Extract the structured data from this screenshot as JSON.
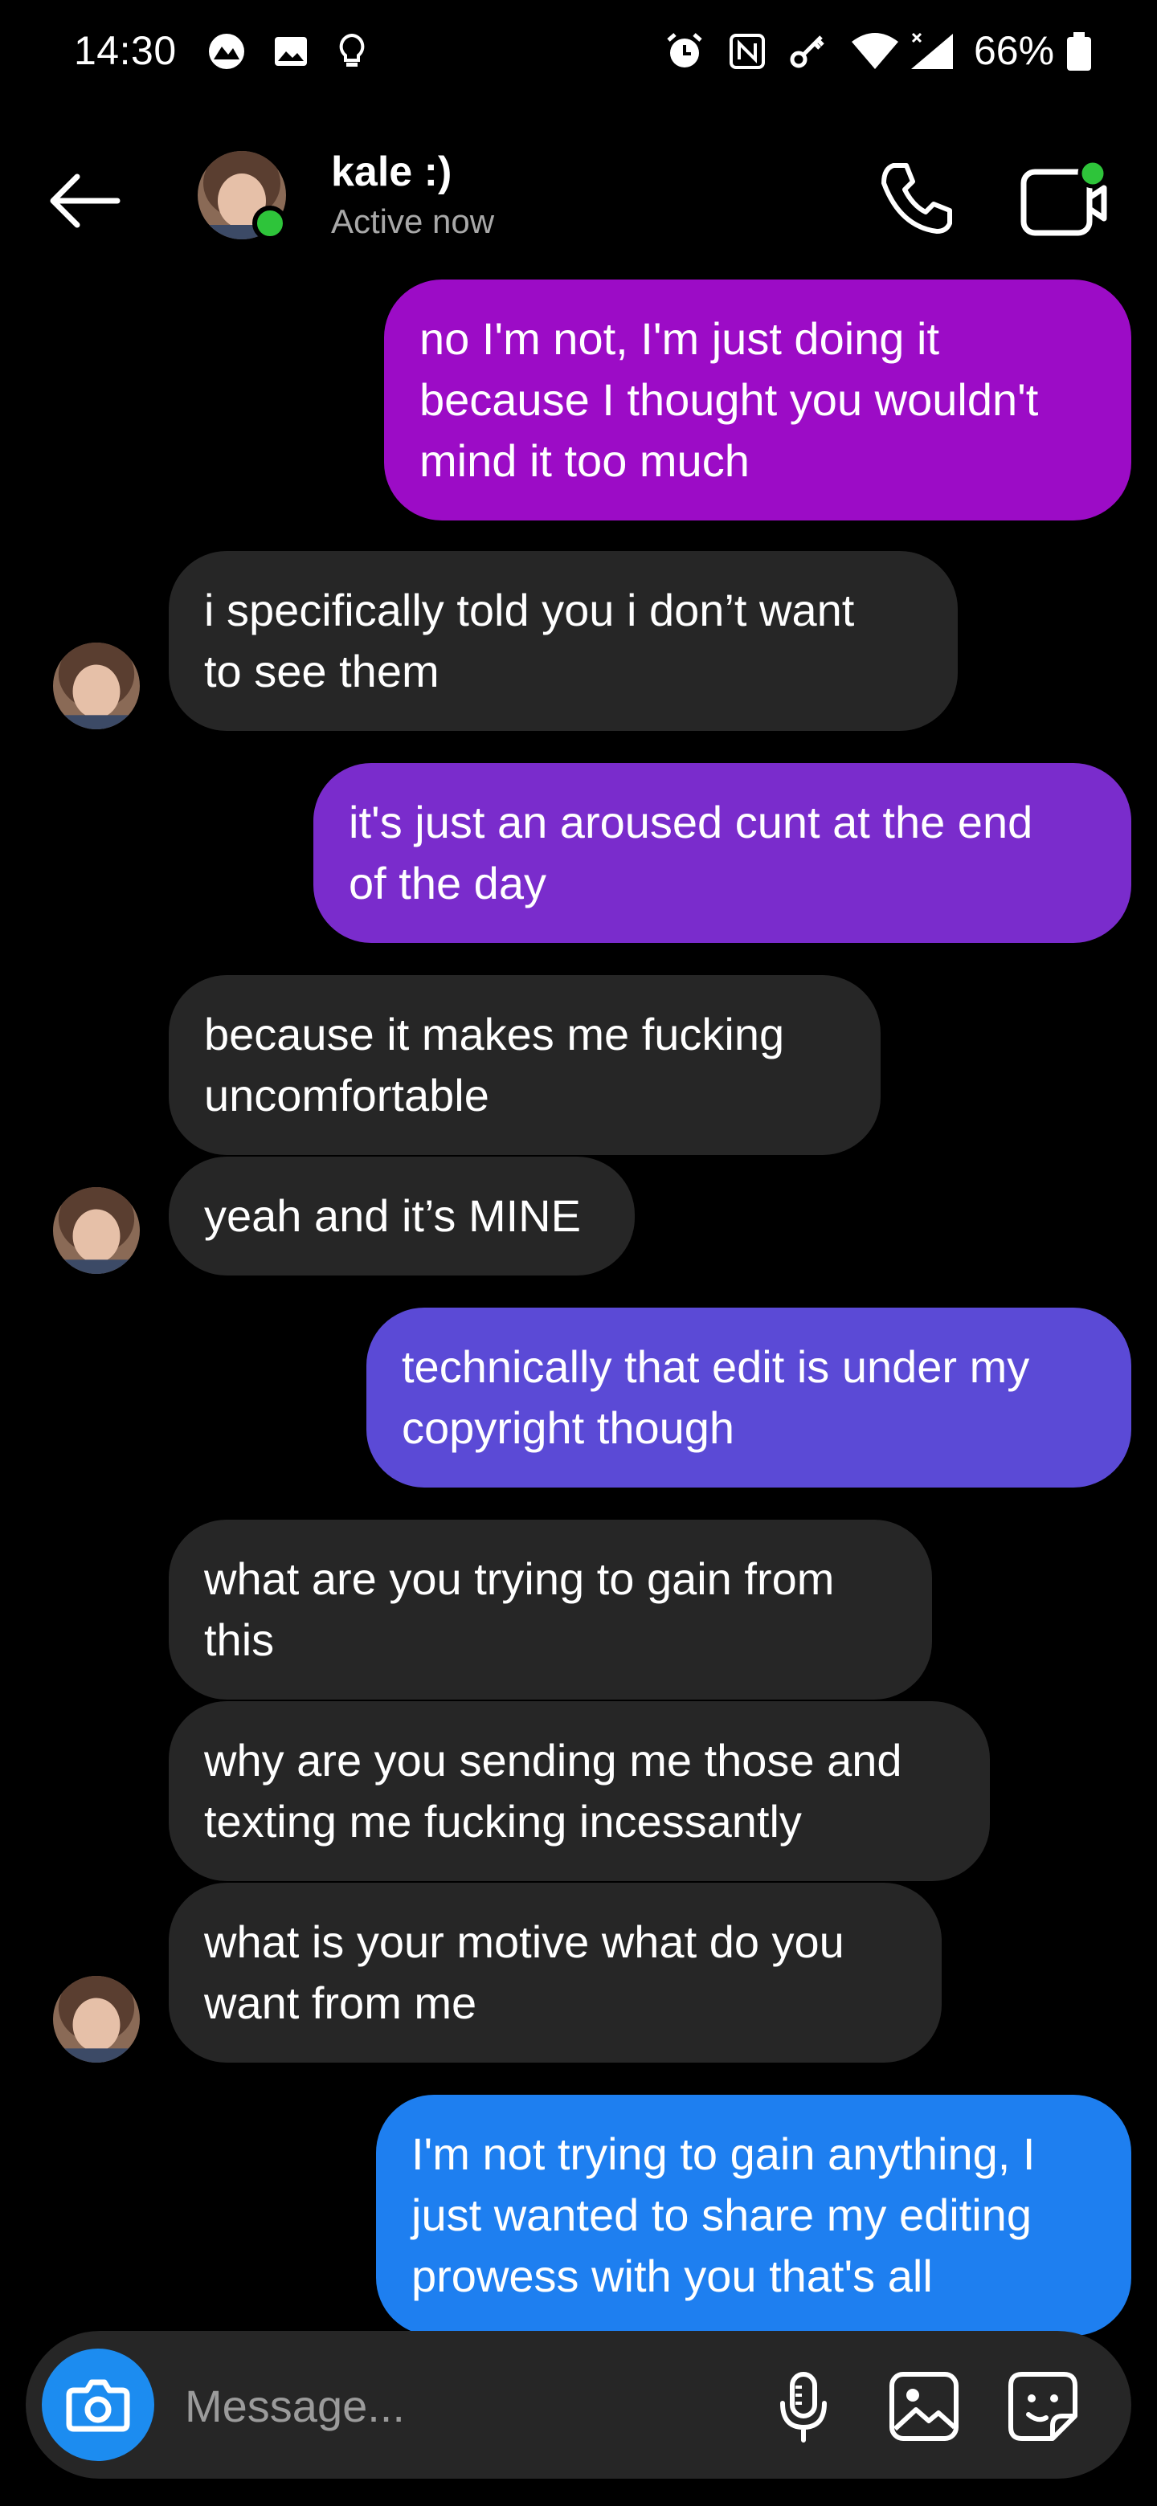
{
  "status_bar": {
    "time": "14:30",
    "battery": "66%",
    "left_icons": [
      "nav-app-icon",
      "image-icon",
      "lightbulb-icon"
    ],
    "right_icons": [
      "alarm-icon",
      "nfc-icon",
      "key-icon",
      "wifi-icon",
      "signal-icon",
      "battery-icon"
    ]
  },
  "header": {
    "contact_name": "kale :)",
    "presence": "Active now"
  },
  "messages": [
    {
      "side": "out",
      "text": "no I'm not, I'm just doing it\nbecause I thought you wouldn't\nmind it too much",
      "color": "#9c0cc6"
    },
    {
      "side": "in",
      "text": "i specifically told you i don’t want\nto see them",
      "color": "#262626"
    },
    {
      "side": "out",
      "text": "it's just an aroused cunt at the end\nof the day",
      "color": "#7a2ccc"
    },
    {
      "side": "in",
      "text": "because it makes me fucking\nuncomfortable",
      "color": "#262626"
    },
    {
      "side": "in",
      "text": "yeah and it’s MINE",
      "color": "#262626"
    },
    {
      "side": "out",
      "text": "technically that edit is under my\ncopyright though",
      "color": "#5b4ad6"
    },
    {
      "side": "in",
      "text": "what are you trying to gain from\nthis",
      "color": "#262626"
    },
    {
      "side": "in",
      "text": "why are you sending me those and\ntexting me fucking incessantly",
      "color": "#262626"
    },
    {
      "side": "in",
      "text": "what is your motive what do you\nwant from me",
      "color": "#262626"
    },
    {
      "side": "out",
      "text": "I'm not trying to gain anything, I\njust wanted to share my editing\nprowess with you that's all",
      "color": "#1e7ff0"
    }
  ],
  "composer": {
    "placeholder": "Message..."
  },
  "colors": {
    "online": "#2ec43a",
    "camera_button": "#1c8cf0",
    "incoming_bubble": "#262626"
  }
}
